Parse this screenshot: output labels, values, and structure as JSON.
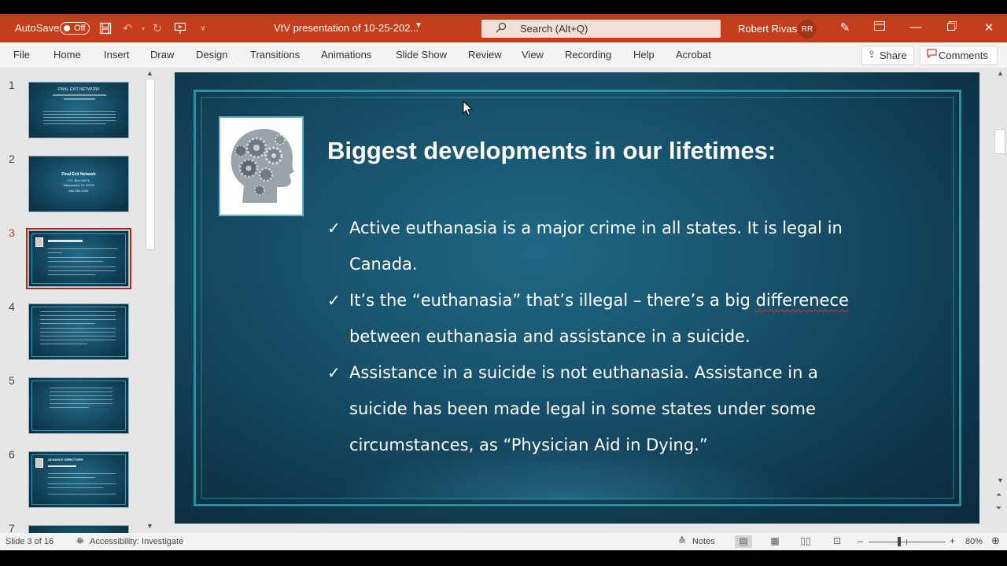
{
  "titlebar": {
    "autosave_label": "AutoSave",
    "autosave_state": "Off",
    "doc_title": "VtV presentation of 10-25-202...",
    "search_placeholder": "Search (Alt+Q)",
    "user_name": "Robert Rivas",
    "user_initials": "RR",
    "accent_color": "#c43e1c"
  },
  "ribbon": {
    "tabs": [
      "File",
      "Home",
      "Insert",
      "Draw",
      "Design",
      "Transitions",
      "Animations",
      "Slide Show",
      "Review",
      "View",
      "Recording",
      "Help",
      "Acrobat"
    ],
    "share_label": "Share",
    "comments_label": "Comments"
  },
  "thumbnails": {
    "numbers": [
      "1",
      "2",
      "3",
      "4",
      "5",
      "6",
      "7"
    ],
    "selected": "3",
    "slide1_title": "FINAL EXIT NETWORK",
    "slide2_lines": [
      "Final Exit Network",
      "P.O. Box 10071",
      "Tallahassee, FL 32302",
      "866-654-9156"
    ],
    "slide6_title": "ADVANCE DIRECTIVES"
  },
  "slide": {
    "title": "Biggest developments in our lifetimes:",
    "check": "✓",
    "bullets": [
      {
        "text": "Active euthanasia is a major crime in all states. It is legal in Canada."
      },
      {
        "before": "It’s the “euthanasia” that’s illegal – there’s a big ",
        "misspelled": "differenece",
        "after": " between euthanasia and assistance in a suicide."
      },
      {
        "text": "Assistance in a suicide is not euthanasia. Assistance in a suicide has been made legal in some states under some circumstances, as “Physician Aid in Dying.”"
      }
    ]
  },
  "statusbar": {
    "slide_info": "Slide 3 of 16",
    "accessibility": "Accessibility: Investigate",
    "notes_label": "Notes",
    "zoom_level": "80%"
  }
}
